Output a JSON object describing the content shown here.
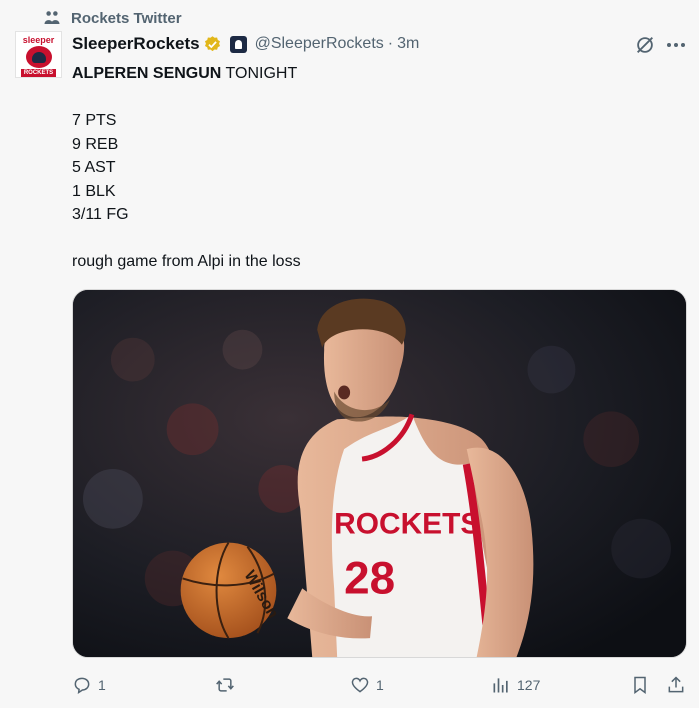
{
  "context": {
    "label": "Rockets Twitter"
  },
  "author": {
    "display_name": "SleeperRockets",
    "handle": "@SleeperRockets",
    "separator": "·",
    "time": "3m",
    "avatar_text_top": "sleeper",
    "avatar_text_bottom": "ROCKETS"
  },
  "tweet": {
    "headline_bold": "ALPEREN SENGUN",
    "headline_rest": " TONIGHT",
    "stats": [
      "7 PTS",
      "9 REB",
      "5 AST",
      "1 BLK",
      "3/11 FG"
    ],
    "closing": "rough game from Alpi in the loss"
  },
  "media": {
    "jersey_text": "ROCKETS",
    "jersey_number": "28",
    "ball_brand": "Wilson"
  },
  "actions": {
    "reply_count": "1",
    "retweet_count": "",
    "like_count": "1",
    "view_count": "127"
  },
  "colors": {
    "background": "#f7f7f7",
    "secondary_text": "#536471",
    "verified_gold": "#e2b719",
    "rockets_red": "#c8102e"
  }
}
